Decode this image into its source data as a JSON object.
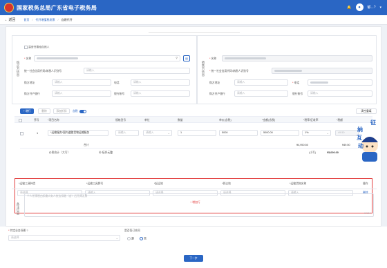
{
  "header": {
    "app_title": "国家税务总局广东省电子税务局",
    "user": "郁...?"
  },
  "nav": {
    "back": "返回",
    "crumbs": [
      "首页",
      "代开增值税发票",
      "自建代开"
    ]
  },
  "buyer": {
    "section_title": "购买方信息",
    "natural_person": "是否开票给自然人",
    "name_label": "名称",
    "taxid_label": "统一社会信用代码/纳税人识别号",
    "taxid_placeholder": "请输入",
    "addr_label": "购方地址",
    "addr_placeholder": "请输入",
    "phone_label": "电话",
    "phone_placeholder": "请输入",
    "bank_label": "购方开户银行",
    "bank_placeholder": "请输入",
    "acct_label": "银行账号",
    "acct_placeholder": "请输入"
  },
  "seller": {
    "section_title": "销售方信息",
    "name_label": "名称",
    "taxid_label": "统一社会信用代码/纳税人识别号",
    "addr_label": "购方地址",
    "addr_placeholder": "请输入",
    "phone_label": "电话",
    "bank_label": "购方开户银行",
    "bank_placeholder": "请输入",
    "acct_label": "银行账号",
    "acct_placeholder": "请输入"
  },
  "toolbar": {
    "add_row": "+ 增行",
    "delete": "删除",
    "discount": "添加折扣",
    "tax_incl": "含税",
    "clear": "清空重填"
  },
  "table": {
    "headers": [
      "序号",
      "*项目名称",
      "规格型号",
      "单位",
      "数量",
      "单价(含税)",
      "*金额(含税)",
      "*税率/征收率",
      "*税额"
    ],
    "row": {
      "index": "1",
      "item": "*运输服务*国内道路货物运输服务",
      "spec": "请输入",
      "unit": "请输入",
      "qty": "1",
      "price": "5000",
      "amount": "5000.00",
      "rate": "1%",
      "tax": "49.50"
    },
    "subtotal_label": "合计",
    "subtotal_amount": "¥4,950.50",
    "subtotal_tax": "¥49.50",
    "total_label": "价税合计（大写）",
    "total_words": "伍仟元整",
    "total_small_label": "(小写)",
    "total_small": "¥5,000.00"
  },
  "transport": {
    "col1": "*运输工具种类",
    "col2": "*运输工具牌号",
    "col3": "*起运地",
    "col4": "*到达地",
    "col5": "*运输货物名称",
    "col6": "操作",
    "p1": "请选择",
    "p2": "请输入",
    "p3": "请选择",
    "p4": "请选择",
    "p5": "请输入",
    "delete": "删除",
    "add": "+ 增加行"
  },
  "remarks": {
    "section_title": "备注信息",
    "placeholder": "个人所得税由扣缴义务人依法扣缴（含）后开具发票",
    "counter": "0/100"
  },
  "footer": {
    "scene_label": "特定业务场景",
    "scene_help": "?",
    "scene_placeholder": "请选择",
    "sign_label": "是否签订合同",
    "yes": "是",
    "no": "否",
    "next": "下一步"
  },
  "mascot": {
    "c1": "征",
    "c2": "纳",
    "c3": "互",
    "c4": "动"
  }
}
